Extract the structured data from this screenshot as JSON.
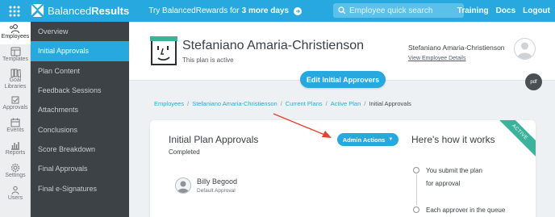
{
  "topbar": {
    "brand_regular": "Balanced",
    "brand_bold": "Results",
    "promo_prefix": "Try BalancedRewards for",
    "promo_days": "3 more days",
    "search_placeholder": "Employee quick search",
    "links": [
      "Training",
      "Docs",
      "Logout"
    ]
  },
  "iconbar": {
    "items": [
      {
        "label": "Employees",
        "icon": "employees-icon",
        "active": true
      },
      {
        "label": "Templates",
        "icon": "templates-icon",
        "active": false
      },
      {
        "label": "Goal Libraries",
        "icon": "goal-libraries-icon",
        "active": false
      },
      {
        "label": "Approvals",
        "icon": "approvals-icon",
        "active": false
      },
      {
        "label": "Events",
        "icon": "events-icon",
        "active": false
      },
      {
        "label": "Reports",
        "icon": "reports-icon",
        "active": false
      },
      {
        "label": "Settings",
        "icon": "settings-icon",
        "active": false
      },
      {
        "label": "Users",
        "icon": "users-icon",
        "active": false
      }
    ]
  },
  "sidebar": {
    "items": [
      {
        "label": "Overview",
        "active": false
      },
      {
        "label": "Initial Approvals",
        "active": true
      },
      {
        "label": "Plan Content",
        "active": false
      },
      {
        "label": "Feedback Sessions",
        "active": false
      },
      {
        "label": "Attachments",
        "active": false
      },
      {
        "label": "Conclusions",
        "active": false
      },
      {
        "label": "Score Breakdown",
        "active": false
      },
      {
        "label": "Final Approvals",
        "active": false
      },
      {
        "label": "Final e-Signatures",
        "active": false
      }
    ]
  },
  "header": {
    "employee_name": "Stefaniano Amaria-Christienson",
    "plan_status": "This plan is active",
    "right_name": "Stefaniano Amaria-Christienson",
    "view_details": "View Employee Details"
  },
  "actions": {
    "edit_label": "Edit Initial Approvers",
    "pdf_label": "pdf"
  },
  "breadcrumb": {
    "links": [
      "Employees",
      "Stefaniano Amaria-Christienson",
      "Current Plans",
      "Active Plan"
    ],
    "current": "Initial Approvals"
  },
  "card": {
    "title": "Initial Plan Approvals",
    "status": "Completed",
    "admin_label": "Admin Actions",
    "how_title": "Here's how it works",
    "ribbon": "ACTIVE",
    "approver": {
      "name": "Billy Begood",
      "role": "Default Approval"
    },
    "steps": [
      "You submit the plan",
      "for approval",
      "Each approver in the queue"
    ]
  },
  "colors": {
    "accent": "#27a9df",
    "sidebar": "#3d4246",
    "ribbon": "#3bb39a",
    "arrow": "#e5432f"
  }
}
